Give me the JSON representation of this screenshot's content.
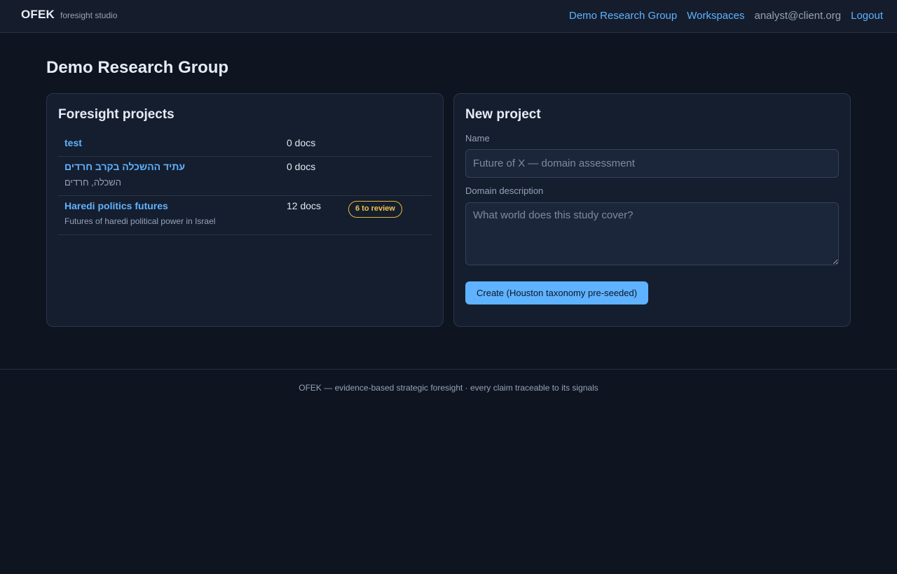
{
  "header": {
    "brand": "OFEK",
    "brand_subtitle": "foresight studio",
    "nav": {
      "group_link": "Demo Research Group",
      "workspaces_link": "Workspaces",
      "user_email": "analyst@client.org",
      "logout_link": "Logout"
    }
  },
  "page": {
    "title": "Demo Research Group"
  },
  "projects_panel": {
    "title": "Foresight projects",
    "projects": [
      {
        "name": "test",
        "description": "",
        "docs": "0 docs",
        "review_badge": ""
      },
      {
        "name": "עתיד ההשכלה בקרב חרדים",
        "description": "השכלה, חרדים",
        "docs": "0 docs",
        "review_badge": ""
      },
      {
        "name": "Haredi politics futures",
        "description": "Futures of haredi political power in Israel",
        "docs": "12 docs",
        "review_badge": "6 to review"
      }
    ]
  },
  "new_project": {
    "title": "New project",
    "name_label": "Name",
    "name_placeholder": "Future of X — domain assessment",
    "description_label": "Domain description",
    "description_placeholder": "What world does this study cover?",
    "create_button": "Create (Houston taxonomy pre-seeded)"
  },
  "footer": {
    "text": "OFEK — evidence-based strategic foresight · every claim traceable to its signals"
  },
  "colors": {
    "background": "#0e1420",
    "panel": "#151e2e",
    "accent": "#5fb2ff",
    "badge": "#f0c24a",
    "muted": "#94a3b8"
  }
}
